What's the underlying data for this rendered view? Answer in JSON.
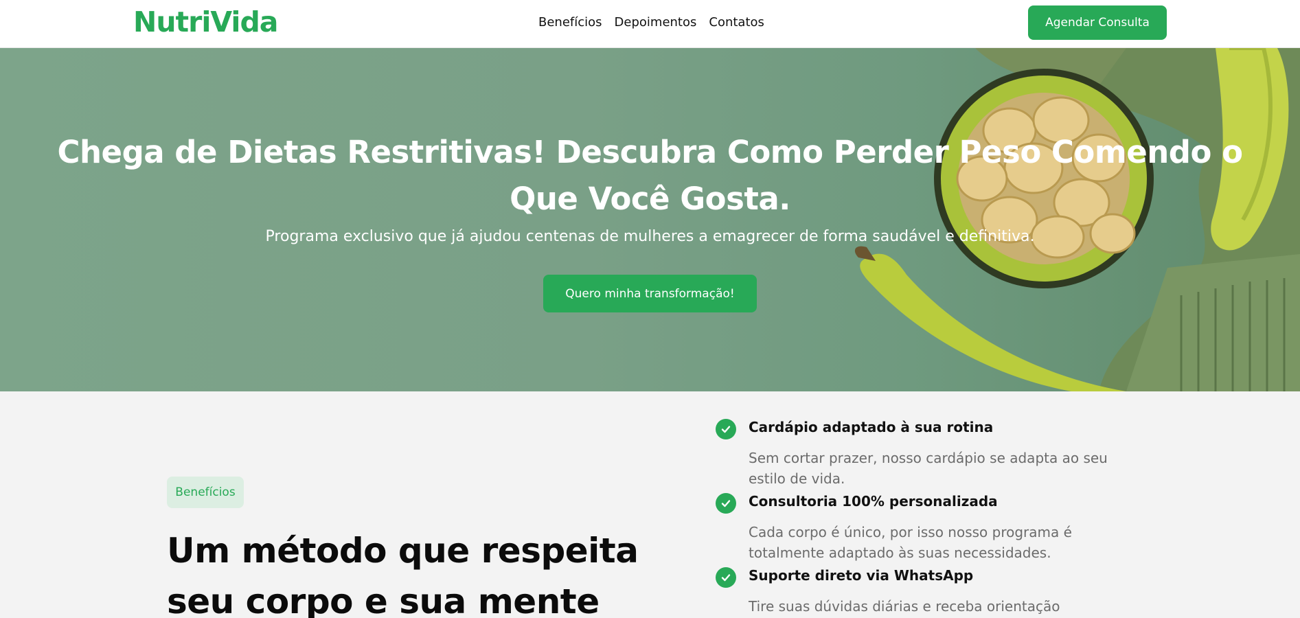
{
  "header": {
    "logo": "NutriVida",
    "nav": [
      "Benefícios",
      "Depoimentos",
      "Contatos"
    ],
    "cta": "Agendar Consulta"
  },
  "hero": {
    "title": "Chega de Dietas Restritivas! Descubra Como Perder Peso Comendo o Que Você Gosta.",
    "subtitle": "Programa exclusivo que já ajudou centenas de mulheres a emagrecer de forma saudável e definitiva.",
    "button": "Quero minha transformação!"
  },
  "benefits": {
    "badge": "Benefícios",
    "title": "Um método que respeita seu corpo e sua mente",
    "items": [
      {
        "title": "Cardápio adaptado à sua rotina",
        "desc": "Sem cortar prazer, nosso cardápio se adapta ao seu estilo de vida."
      },
      {
        "title": "Consultoria 100% personalizada",
        "desc": "Cada corpo é único, por isso nosso programa é totalmente adaptado às suas necessidades."
      },
      {
        "title": "Suporte direto via WhatsApp",
        "desc": "Tire suas dúvidas diárias e receba orientação"
      }
    ]
  },
  "colors": {
    "brand": "#28a957",
    "hero_bg": "#7aa087",
    "section_bg": "#f3f3f3"
  }
}
